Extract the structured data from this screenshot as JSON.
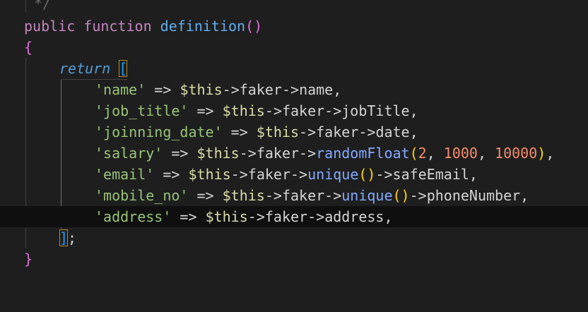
{
  "colors": {
    "background": "#1e1e1e",
    "keyword": "#c586c0",
    "function_name": "#61afef",
    "string": "#98c379",
    "variable": "#dcdcaa",
    "method_call": "#82aaff",
    "number": "#f78c6c",
    "bracket": "#179fff"
  },
  "lines": {
    "l0": {
      "comment": "*/"
    },
    "l1": {
      "kw1": "public",
      "kw2": "function",
      "name": "definition",
      "paren": "()"
    },
    "l2": {
      "brace": "{"
    },
    "l3": {
      "ret": "return",
      "bracket": "["
    },
    "l4": {
      "key": "'name'",
      "op": "=>",
      "this": "$this",
      "a1": "->",
      "faker": "faker",
      "a2": "->",
      "tail": "name,"
    },
    "l5": {
      "key": "'job_title'",
      "op": "=>",
      "this": "$this",
      "a1": "->",
      "faker": "faker",
      "a2": "->",
      "tail": "jobTitle,"
    },
    "l6": {
      "key": "'joinning_date'",
      "op": "=>",
      "this": "$this",
      "a1": "->",
      "faker": "faker",
      "a2": "->",
      "tail": "date,"
    },
    "l7": {
      "key": "'salary'",
      "op": "=>",
      "this": "$this",
      "a1": "->",
      "faker": "faker",
      "a2": "->",
      "method": "randomFloat",
      "po": "(",
      "n1": "2",
      "c1": ", ",
      "n2": "1000",
      "c2": ", ",
      "n3": "10000",
      "pc": ")",
      "end": ","
    },
    "l8": {
      "key": "'email'",
      "op": "=>",
      "this": "$this",
      "a1": "->",
      "faker": "faker",
      "a2": "->",
      "method": "unique",
      "parens": "()",
      "a3": "->",
      "tail": "safeEmail,"
    },
    "l9": {
      "key": "'mobile_no'",
      "op": "=>",
      "this": "$this",
      "a1": "->",
      "faker": "faker",
      "a2": "->",
      "method": "unique",
      "parens": "()",
      "a3": "->",
      "tail": "phoneNumber,"
    },
    "l10": {
      "key": "'address'",
      "op": "=>",
      "this": "$this",
      "a1": "->",
      "faker": "faker",
      "a2": "->",
      "tail": "address,"
    },
    "l11": {
      "bracket": "]",
      "semi": ";"
    },
    "l12": {
      "brace": "}"
    }
  }
}
